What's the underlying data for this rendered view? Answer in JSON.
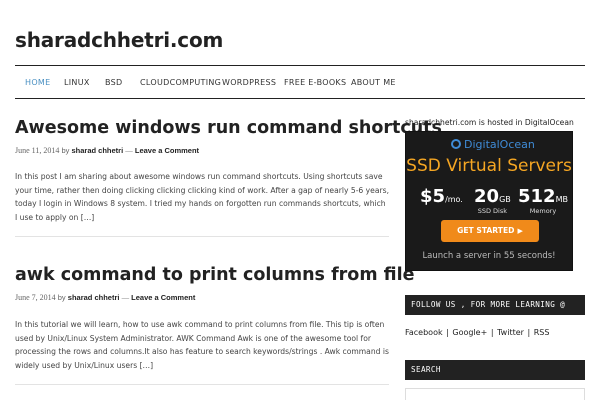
{
  "site": {
    "title": "sharadchhetri.com"
  },
  "nav": {
    "items": [
      {
        "label": "HOME",
        "active": true
      },
      {
        "label": "LINUX"
      },
      {
        "label": "BSD"
      },
      {
        "label": "CLOUDCOMPUTING"
      },
      {
        "label": "WORDPRESS"
      },
      {
        "label": "FREE E-BOOKS"
      },
      {
        "label": "ABOUT ME"
      }
    ]
  },
  "posts": [
    {
      "title": "Awesome windows run command shortcuts",
      "date": "June 11, 2014",
      "by": "by",
      "author": "sharad chhetri",
      "dash": "—",
      "comment": "Leave a Comment",
      "excerpt": "In this post I am sharing about awesome windows run command shortcuts. Using shortcuts save your time, rather then doing clicking clicking clicking kind of work. After a gap of nearly 5-6 years, today I login in Windows 8 system. I tried my hands on forgotten run commands shortcuts, which I use to apply on […]"
    },
    {
      "title": "awk command to print columns from file",
      "date": "June 7, 2014",
      "by": "by",
      "author": "sharad chhetri",
      "dash": "—",
      "comment": "Leave a Comment",
      "excerpt": "In this tutorial we will learn, how to use awk command to print columns from file. This tip is often used by Unix/Linux System Administrator. AWK Command Awk is one of the awesome tool for processing the rows and columns.It also has feature to search keywords/strings . Awk command is widely used by Unix/Linux users […]"
    }
  ],
  "sidebar": {
    "hosted_text": "sharadchhetri.com is hosted in DigitalOcean",
    "ad": {
      "brand": "DigitalOcean",
      "headline": "SSD Virtual Servers",
      "price": "$5",
      "price_unit": "/mo.",
      "disk_value": "20",
      "disk_unit": "GB",
      "disk_label": "SSD Disk",
      "memory_value": "512",
      "memory_unit": "MB",
      "memory_label": "Memory",
      "cta": "GET STARTED",
      "tagline": "Launch a server in 55 seconds!"
    },
    "follow_heading": "FOLLOW US , FOR MORE LEARNING @",
    "social": [
      {
        "label": "Facebook"
      },
      {
        "label": "Google+"
      },
      {
        "label": "Twitter"
      },
      {
        "label": "RSS"
      }
    ],
    "social_sep": "|",
    "search_heading": "SEARCH"
  },
  "colors": {
    "accent": "#4a90c2",
    "ad_orange": "#f08a1a",
    "ad_headline": "#f5a623",
    "digitalocean_blue": "#3f8bd6"
  }
}
